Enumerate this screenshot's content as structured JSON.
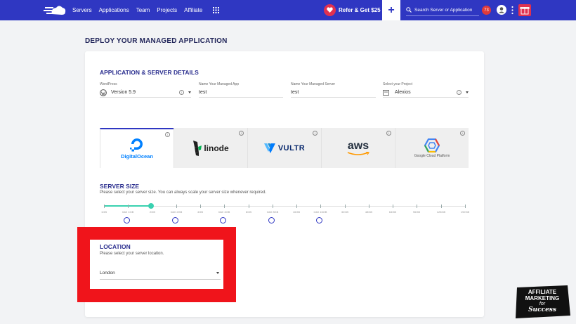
{
  "topnav": {
    "links": [
      "Servers",
      "Applications",
      "Team",
      "Projects",
      "Affiliate"
    ],
    "refer_label": "Refer & Get $25",
    "search_placeholder": "Search Server or Application",
    "notification_count": "73",
    "colors": {
      "bar": "#2f37c2",
      "accent": "#e1314f"
    }
  },
  "page_title": "DEPLOY YOUR MANAGED APPLICATION",
  "details": {
    "title": "APPLICATION & SERVER DETAILS",
    "app_label": "WordPress",
    "app_version": "Version 5.9",
    "app_name_label": "Name Your Managed App",
    "app_name_value": "test",
    "server_name_label": "Name Your Managed Server",
    "server_name_value": "test",
    "project_label": "Select your Project",
    "project_value": "Alexios"
  },
  "providers": [
    {
      "name": "DigitalOcean",
      "active": true
    },
    {
      "name": "linode",
      "active": false
    },
    {
      "name": "VULTR",
      "active": false
    },
    {
      "name": "aws",
      "active": false
    },
    {
      "name": "Google Cloud Platform",
      "active": false
    }
  ],
  "server_size": {
    "title": "SERVER SIZE",
    "description": "Please select your server size. You can always scale your server size whenever required.",
    "sizes": [
      "1GB",
      "Intel 1GB",
      "2GB",
      "Intel 2GB",
      "4GB",
      "Intel 4GB",
      "8GB",
      "Intel 8GB",
      "16GB",
      "Intel 16GB",
      "32GB",
      "48GB",
      "64GB",
      "96GB",
      "128GB",
      "192GB"
    ],
    "selected": "2GB"
  },
  "location": {
    "title": "LOCATION",
    "description": "Please select your server location.",
    "value": "London"
  },
  "badge": {
    "line1": "AFFILIATE",
    "line2": "MARKETING",
    "line3": "for",
    "line4": "Success"
  }
}
